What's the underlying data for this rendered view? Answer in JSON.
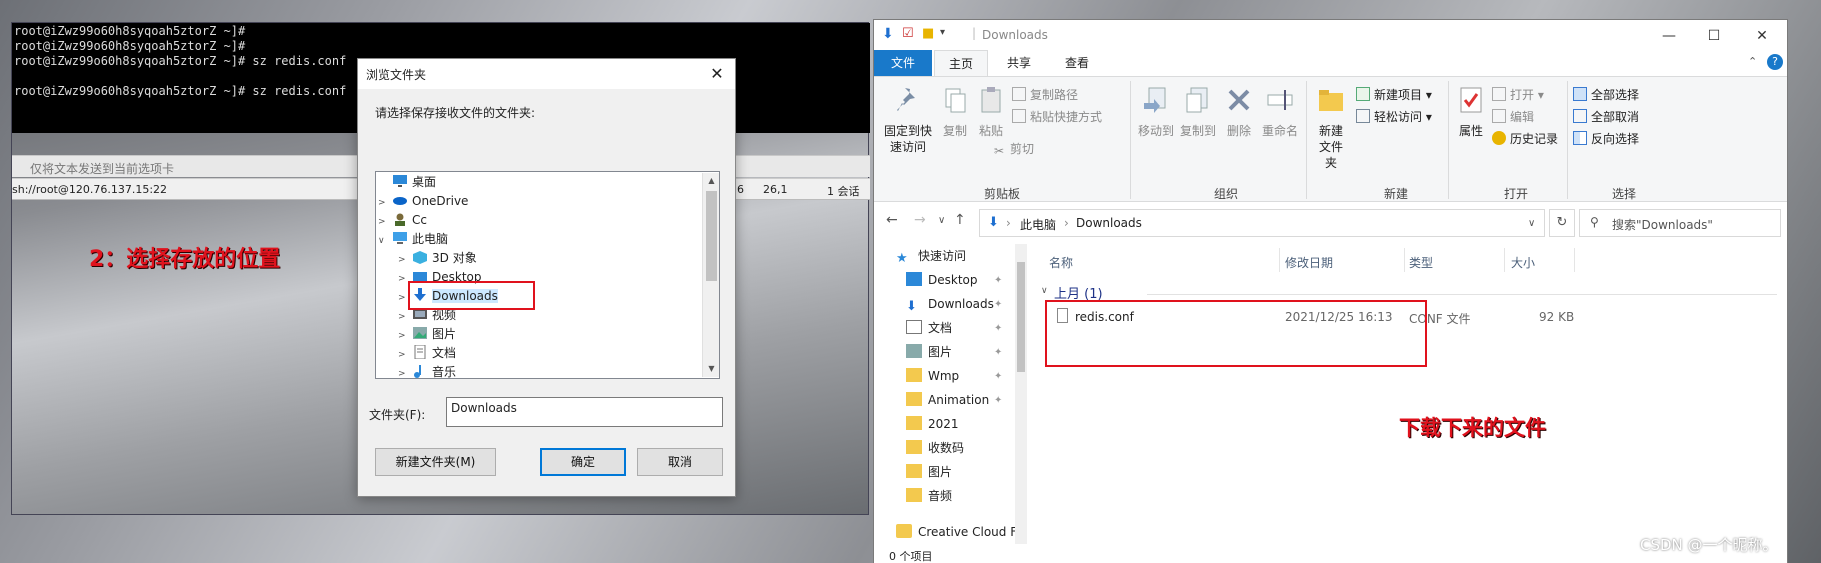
{
  "terminal": {
    "lines": [
      "root@iZwz99o60h8syqoah5ztorZ ~]#",
      "root@iZwz99o60h8syqoah5ztorZ ~]#",
      "root@iZwz99o60h8syqoah5ztorZ ~]# sz redis.conf",
      "",
      "root@iZwz99o60h8syqoah5ztorZ ~]# sz redis.conf"
    ],
    "input_placeholder": "仅将文本发送到当前选项卡",
    "status_host": "sh://root@120.76.137.15:22",
    "status_col": "6",
    "status_pos": "26,1",
    "status_sessions": "1 会话"
  },
  "annotations": {
    "step": "2：选择存放的位置",
    "downloaded": "下载下来的文件"
  },
  "browse_dialog": {
    "title": "浏览文件夹",
    "prompt": "请选择保存接收文件的文件夹:",
    "tree": [
      {
        "label": "桌面",
        "icon": "desktop-icon"
      },
      {
        "label": "OneDrive",
        "icon": "cloud-icon"
      },
      {
        "label": "Cc",
        "icon": "user-icon"
      },
      {
        "label": "此电脑",
        "icon": "computer-icon"
      },
      {
        "label": "3D 对象",
        "icon": "cube-icon"
      },
      {
        "label": "Desktop",
        "icon": "folder-icon"
      },
      {
        "label": "Downloads",
        "icon": "download-arrow-icon"
      },
      {
        "label": "视频",
        "icon": "video-icon"
      },
      {
        "label": "图片",
        "icon": "picture-icon"
      },
      {
        "label": "文档",
        "icon": "document-icon"
      },
      {
        "label": "音乐",
        "icon": "music-icon"
      }
    ],
    "folder_label": "文件夹(F):",
    "folder_value": "Downloads",
    "new_folder_button": "新建文件夹(M)",
    "ok_button": "确定",
    "cancel_button": "取消"
  },
  "explorer": {
    "title": "Downloads",
    "tabs": [
      "文件",
      "主页",
      "共享",
      "查看"
    ],
    "ribbon": {
      "pin_quick": "固定到快速访问",
      "copy": "复制",
      "paste": "粘贴",
      "copy_path": "复制路径",
      "paste_shortcut": "粘贴快捷方式",
      "cut": "剪切",
      "clipboard_group": "剪贴板",
      "move_to": "移动到",
      "copy_to": "复制到",
      "delete": "删除",
      "rename": "重命名",
      "organize_group": "组织",
      "new_folder": "新建文件夹",
      "new_item": "新建项目",
      "easy_access": "轻松访问",
      "new_group": "新建",
      "properties": "属性",
      "open": "打开",
      "edit": "编辑",
      "history": "历史记录",
      "open_group": "打开",
      "select_all": "全部选择",
      "select_none": "全部取消",
      "invert_selection": "反向选择",
      "select_group": "选择"
    },
    "address": {
      "crumb_pc": "此电脑",
      "crumb_downloads": "Downloads",
      "search_placeholder": "搜索\"Downloads\""
    },
    "nav": [
      {
        "label": "快速访问",
        "icon": "star-icon",
        "pinned": false
      },
      {
        "label": "Desktop",
        "icon": "desktop-icon",
        "pinned": true
      },
      {
        "label": "Downloads",
        "icon": "download-arrow-icon",
        "pinned": true
      },
      {
        "label": "文档",
        "icon": "document-icon",
        "pinned": true
      },
      {
        "label": "图片",
        "icon": "picture-icon",
        "pinned": true
      },
      {
        "label": "Wmp",
        "icon": "folder-icon",
        "pinned": true
      },
      {
        "label": "Animation",
        "icon": "folder-icon",
        "pinned": true
      },
      {
        "label": "2021",
        "icon": "folder-icon",
        "pinned": false
      },
      {
        "label": "收数码",
        "icon": "folder-icon",
        "pinned": false
      },
      {
        "label": "图片",
        "icon": "folder-icon",
        "pinned": false
      },
      {
        "label": "音频",
        "icon": "folder-icon",
        "pinned": false
      },
      {
        "label": "Creative Cloud F",
        "icon": "creative-cloud-icon",
        "pinned": false
      }
    ],
    "columns": [
      "名称",
      "修改日期",
      "类型",
      "大小"
    ],
    "group_header": "上月 (1)",
    "file": {
      "name": "redis.conf",
      "modified": "2021/12/25 16:13",
      "type": "CONF 文件",
      "size": "92 KB"
    },
    "status": "0 个项目"
  },
  "watermark": "CSDN @一个昵称。",
  "colors": {
    "accent": "#1979ca",
    "annotation_red": "#e0121d",
    "terminal_bg": "#000000"
  }
}
